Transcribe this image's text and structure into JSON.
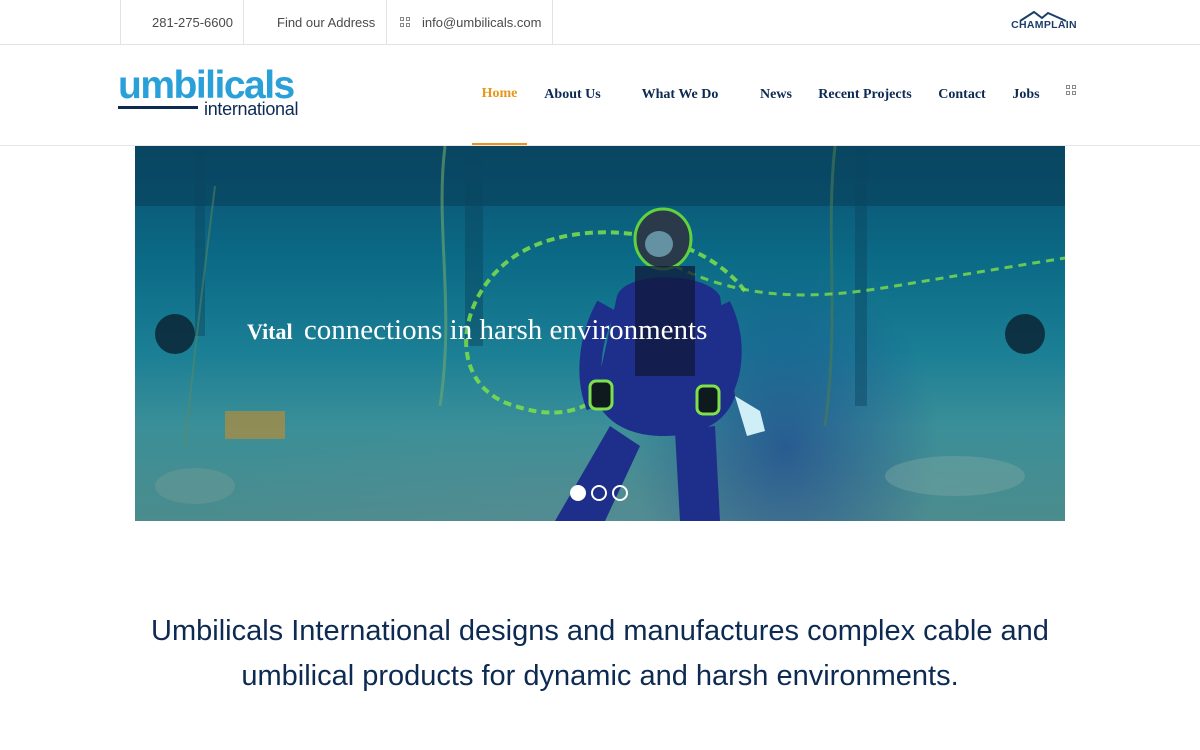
{
  "topbar": {
    "phone": "281-275-6600",
    "address": "Find our Address",
    "email": "info@umbilicals.com",
    "partner_logo_text": "CHAMPLAIN"
  },
  "header": {
    "logo_main": "umbilicals",
    "logo_sub": "international",
    "nav": [
      {
        "label": "Home",
        "active": true
      },
      {
        "label": "About Us",
        "active": false
      },
      {
        "label": "What We Do",
        "active": false
      },
      {
        "label": "News",
        "active": false
      },
      {
        "label": "Recent Projects",
        "active": false
      },
      {
        "label": "Contact",
        "active": false
      },
      {
        "label": "Jobs",
        "active": false
      }
    ],
    "active_color": "#e8961b",
    "nav_color": "#0d2a52"
  },
  "slider": {
    "caption_bold": "Vital",
    "caption_rest": "connections in harsh environments",
    "current_slide": 1,
    "slide_count": 3
  },
  "main": {
    "tagline": "Umbilicals International designs and manufactures complex cable and umbilical products for dynamic and harsh environments."
  },
  "icons": {
    "email": "grid-icon",
    "menu": "grid-menu-icon",
    "prev": "prev-arrow-icon",
    "next": "next-arrow-icon"
  }
}
